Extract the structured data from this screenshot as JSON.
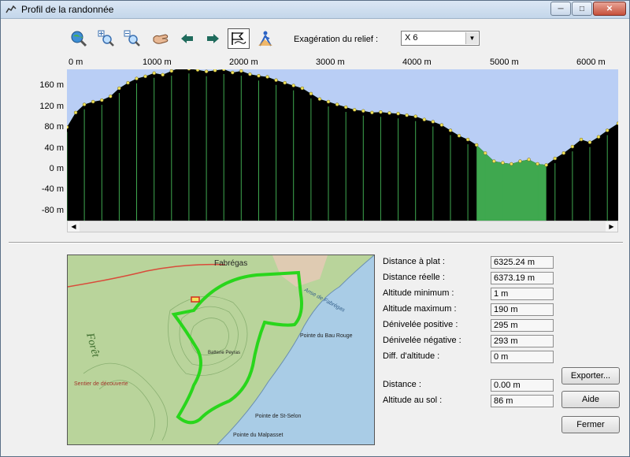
{
  "window": {
    "title": "Profil de la randonnée"
  },
  "toolbar": {
    "tools": [
      "zoom-globe-icon",
      "zoom-in-icon",
      "zoom-out-icon",
      "hand-pan-icon",
      "arrow-left-icon",
      "arrow-right-icon",
      "profile-flag-icon",
      "hiker-icon"
    ],
    "relief_label": "Exagération du relief :",
    "relief_value": "X 6"
  },
  "chart_data": {
    "type": "area",
    "x_ticks": [
      "0 m",
      "1000 m",
      "2000 m",
      "3000 m",
      "4000 m",
      "5000 m",
      "6000 m"
    ],
    "y_ticks": [
      "160 m",
      "120 m",
      "80 m",
      "40 m",
      "0 m",
      "-40 m",
      "-80 m"
    ],
    "xlim": [
      0,
      6325
    ],
    "ylim": [
      -95,
      185
    ],
    "x": [
      0,
      100,
      200,
      300,
      400,
      500,
      600,
      700,
      800,
      900,
      1000,
      1100,
      1200,
      1300,
      1400,
      1500,
      1600,
      1700,
      1800,
      1900,
      2000,
      2100,
      2200,
      2300,
      2400,
      2500,
      2600,
      2700,
      2800,
      2900,
      3000,
      3100,
      3200,
      3300,
      3400,
      3500,
      3600,
      3700,
      3800,
      3900,
      4000,
      4100,
      4200,
      4300,
      4400,
      4500,
      4600,
      4700,
      4800,
      4900,
      5000,
      5100,
      5200,
      5300,
      5400,
      5500,
      5600,
      5700,
      5800,
      5900,
      6000,
      6100,
      6200,
      6325
    ],
    "values": [
      78,
      105,
      120,
      125,
      128,
      135,
      150,
      160,
      168,
      172,
      178,
      175,
      182,
      188,
      186,
      184,
      181,
      183,
      185,
      179,
      182,
      176,
      173,
      171,
      165,
      160,
      155,
      150,
      140,
      130,
      125,
      120,
      115,
      110,
      108,
      105,
      106,
      104,
      103,
      100,
      98,
      92,
      88,
      82,
      72,
      62,
      55,
      45,
      30,
      15,
      12,
      10,
      15,
      18,
      10,
      8,
      20,
      30,
      42,
      55,
      50,
      60,
      72,
      85
    ],
    "area_color": "#000000",
    "sky_color": "#b9cef5",
    "green_color": "#3fa84f",
    "point_color": "#f2e35a"
  },
  "stats": [
    {
      "label": "Distance à plat :",
      "value": "6325.24 m"
    },
    {
      "label": "Distance réelle :",
      "value": "6373.19 m"
    },
    {
      "label": "Altitude minimum :",
      "value": "1 m"
    },
    {
      "label": "Altitude maximum :",
      "value": "190 m"
    },
    {
      "label": "Dénivelée positive :",
      "value": "295 m"
    },
    {
      "label": "Dénivelée négative :",
      "value": "293 m"
    },
    {
      "label": "Diff. d'altitude :",
      "value": "0 m"
    }
  ],
  "cursor": [
    {
      "label": "Distance :",
      "value": "0.00 m"
    },
    {
      "label": "Altitude au sol :",
      "value": "86 m"
    }
  ],
  "buttons": {
    "export": "Exporter...",
    "help": "Aide",
    "close": "Fermer"
  },
  "map": {
    "labels": {
      "fabregas": "Fabrégas",
      "anse": "Anse de Fabrégas",
      "pointe_bau": "Pointe du Bau Rouge",
      "pointe_selon": "Pointe de St-Selon",
      "pointe_malpasset": "Pointe du Malpasset",
      "foret": "Forêt",
      "sentier": "Sentier de découverte",
      "batterie": "Batterie Peyras"
    },
    "land_color": "#b9d49b",
    "sea_color": "#a9cce6",
    "route_color": "#29d61c"
  }
}
